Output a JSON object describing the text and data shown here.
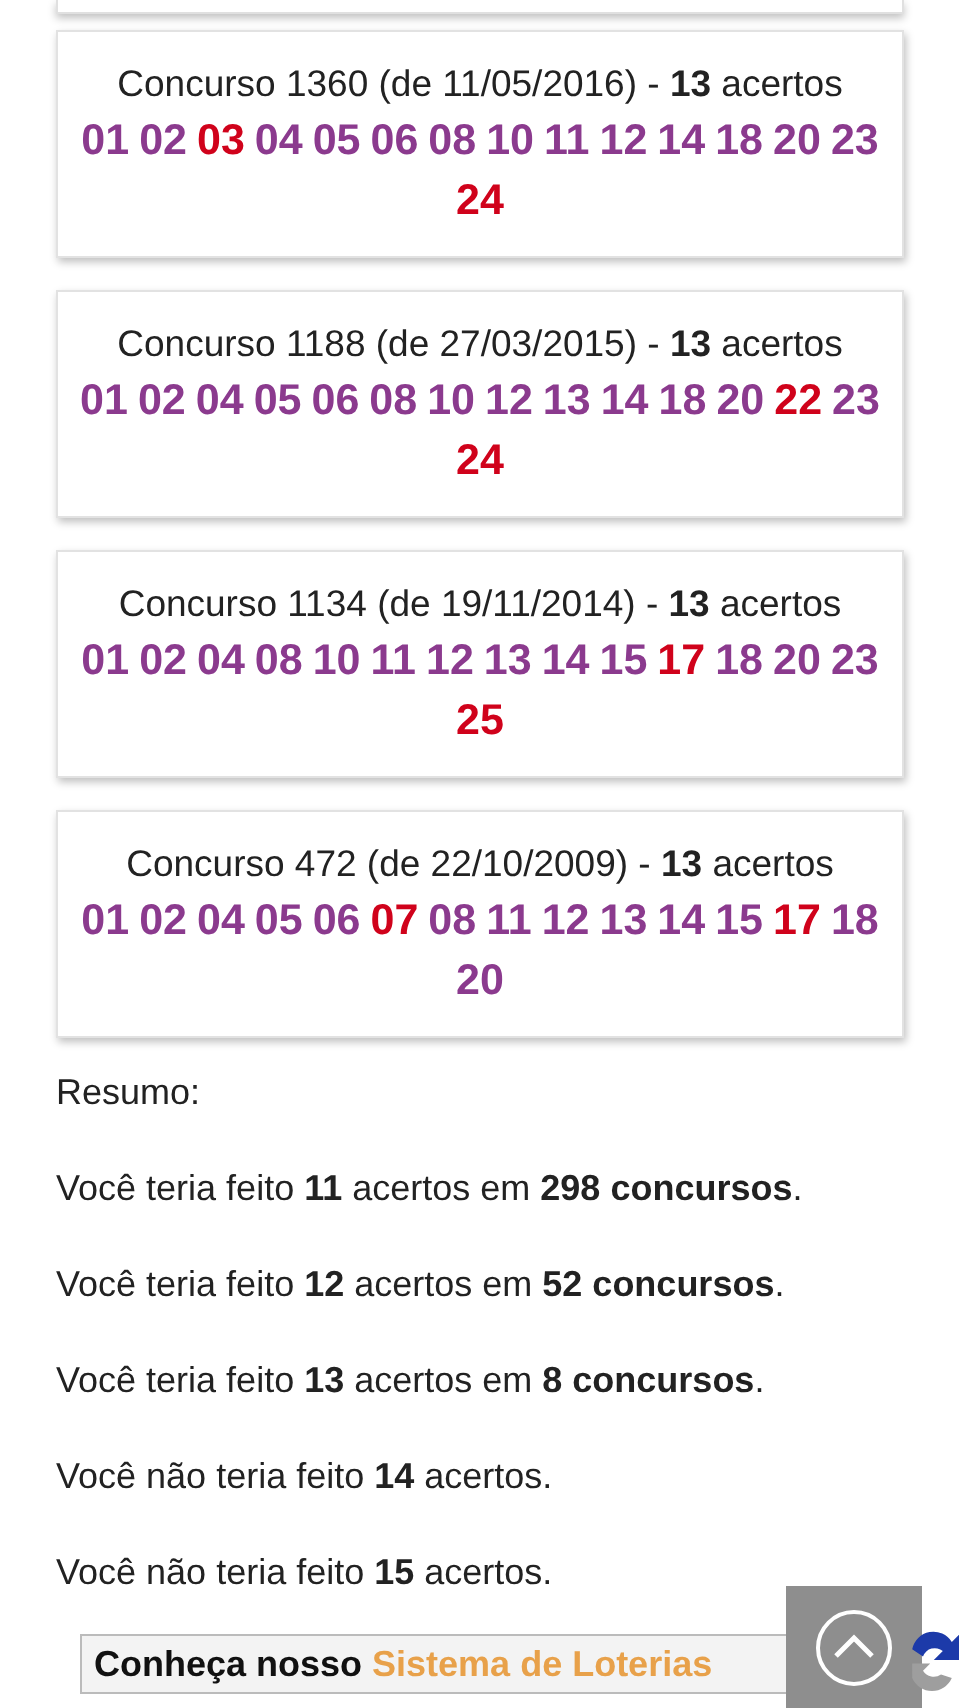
{
  "results": [
    {
      "header": "Concurso 1360 (de 11/05/2016) - **13** acertos",
      "numbers": [
        {
          "text": "01",
          "highlighted": false
        },
        {
          "text": "02",
          "highlighted": false
        },
        {
          "text": "03",
          "highlighted": true
        },
        {
          "text": "04",
          "highlighted": false
        },
        {
          "text": "05",
          "highlighted": false
        },
        {
          "text": "06",
          "highlighted": false
        },
        {
          "text": "08",
          "highlighted": false
        },
        {
          "text": "10",
          "highlighted": false
        },
        {
          "text": "11",
          "highlighted": false
        },
        {
          "text": "12",
          "highlighted": false
        },
        {
          "text": "14",
          "highlighted": false
        },
        {
          "text": "18",
          "highlighted": false
        },
        {
          "text": "20",
          "highlighted": false
        },
        {
          "text": "23",
          "highlighted": false
        },
        {
          "text": "24",
          "highlighted": true
        }
      ]
    },
    {
      "header": "Concurso 1188 (de 27/03/2015) - **13** acertos",
      "numbers": [
        {
          "text": "01",
          "highlighted": false
        },
        {
          "text": "02",
          "highlighted": false
        },
        {
          "text": "04",
          "highlighted": false
        },
        {
          "text": "05",
          "highlighted": false
        },
        {
          "text": "06",
          "highlighted": false
        },
        {
          "text": "08",
          "highlighted": false
        },
        {
          "text": "10",
          "highlighted": false
        },
        {
          "text": "12",
          "highlighted": false
        },
        {
          "text": "13",
          "highlighted": false
        },
        {
          "text": "14",
          "highlighted": false
        },
        {
          "text": "18",
          "highlighted": false
        },
        {
          "text": "20",
          "highlighted": false
        },
        {
          "text": "22",
          "highlighted": true
        },
        {
          "text": "23",
          "highlighted": false
        },
        {
          "text": "24",
          "highlighted": true
        }
      ]
    },
    {
      "header": "Concurso 1134 (de 19/11/2014) - **13** acertos",
      "numbers": [
        {
          "text": "01",
          "highlighted": false
        },
        {
          "text": "02",
          "highlighted": false
        },
        {
          "text": "04",
          "highlighted": false
        },
        {
          "text": "08",
          "highlighted": false
        },
        {
          "text": "10",
          "highlighted": false
        },
        {
          "text": "11",
          "highlighted": false
        },
        {
          "text": "12",
          "highlighted": false
        },
        {
          "text": "13",
          "highlighted": false
        },
        {
          "text": "14",
          "highlighted": false
        },
        {
          "text": "15",
          "highlighted": false
        },
        {
          "text": "17",
          "highlighted": true
        },
        {
          "text": "18",
          "highlighted": false
        },
        {
          "text": "20",
          "highlighted": false
        },
        {
          "text": "23",
          "highlighted": false
        },
        {
          "text": "25",
          "highlighted": true
        }
      ]
    },
    {
      "header": "Concurso 472 (de 22/10/2009) - **13** acertos",
      "numbers": [
        {
          "text": "01",
          "highlighted": false
        },
        {
          "text": "02",
          "highlighted": false
        },
        {
          "text": "04",
          "highlighted": false
        },
        {
          "text": "05",
          "highlighted": false
        },
        {
          "text": "06",
          "highlighted": false
        },
        {
          "text": "07",
          "highlighted": true
        },
        {
          "text": "08",
          "highlighted": false
        },
        {
          "text": "11",
          "highlighted": false
        },
        {
          "text": "12",
          "highlighted": false
        },
        {
          "text": "13",
          "highlighted": false
        },
        {
          "text": "14",
          "highlighted": false
        },
        {
          "text": "15",
          "highlighted": false
        },
        {
          "text": "17",
          "highlighted": true
        },
        {
          "text": "18",
          "highlighted": false
        },
        {
          "text": "20",
          "highlighted": false
        }
      ]
    }
  ],
  "summary": {
    "title": "Resumo:",
    "lines": [
      "Você teria feito **11** acertos em **298 concursos**.",
      "Você teria feito **12** acertos em **52 concursos**.",
      "Você teria feito **13** acertos em **8 concursos**.",
      "Você não teria feito **14** acertos.",
      "Você não teria feito **15** acertos."
    ]
  },
  "promo": {
    "text": "Conheça nosso",
    "link": "Sistema de Loterias"
  }
}
